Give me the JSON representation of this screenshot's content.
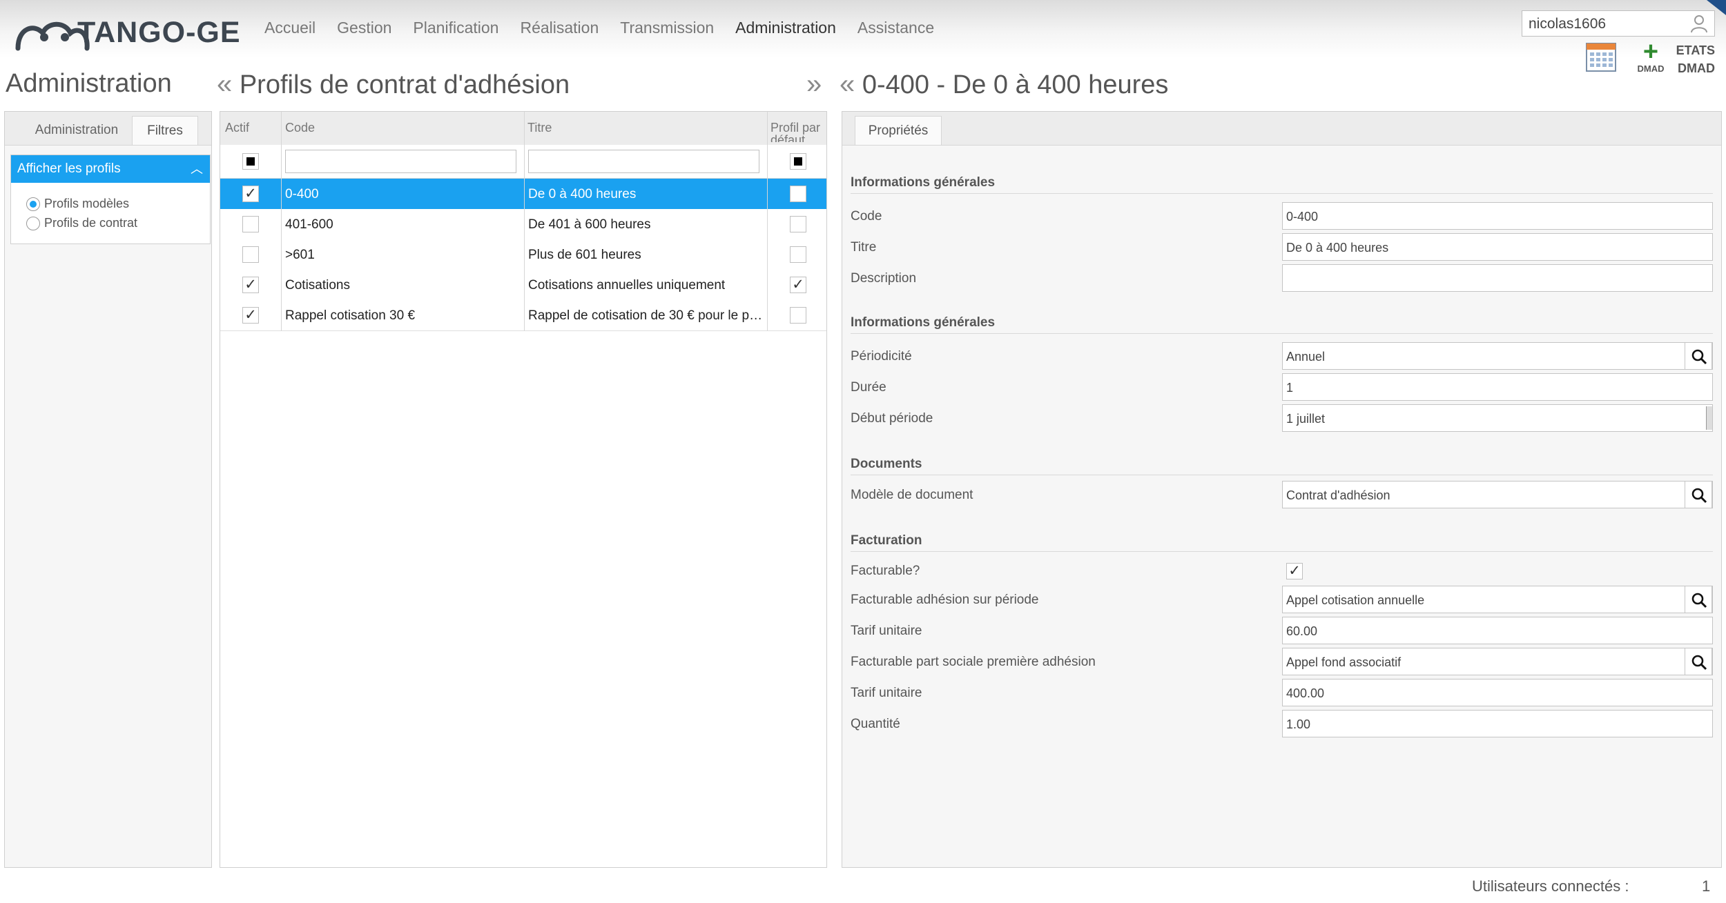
{
  "app": {
    "logo_text": "TANGO-GE",
    "menu": [
      "Accueil",
      "Gestion",
      "Planification",
      "Réalisation",
      "Transmission",
      "Administration",
      "Assistance"
    ],
    "active_menu": "Administration",
    "user": "nicolas1606",
    "tools": {
      "add_label": "DMAD",
      "etats_line1": "ETATS",
      "etats_line2": "DMAD"
    }
  },
  "headings": {
    "left": "Administration",
    "middle": "Profils de contrat d'adhésion",
    "right": "0-400 - De 0 à 400 heures"
  },
  "left_panel": {
    "tabs": [
      "Administration",
      "Filtres"
    ],
    "selected_tab": "Filtres",
    "filter_title": "Afficher les profils",
    "options": [
      "Profils modèles",
      "Profils de contrat"
    ],
    "selected_option": "Profils modèles"
  },
  "grid": {
    "columns": [
      "Actif",
      "Code",
      "Titre",
      "Profil par défaut"
    ],
    "rows": [
      {
        "actif": "✓",
        "code": "0-400",
        "titre": "De 0 à 400 heures",
        "defaut": ""
      },
      {
        "actif": "",
        "code": "401-600",
        "titre": "De 401 à 600 heures",
        "defaut": ""
      },
      {
        "actif": "",
        "code": ">601",
        "titre": "Plus de 601 heures",
        "defaut": ""
      },
      {
        "actif": "✓",
        "code": "Cotisations",
        "titre": "Cotisations annuelles uniquement",
        "defaut": "✓"
      },
      {
        "actif": "✓",
        "code": "Rappel cotisation 30 €",
        "titre": "Rappel de cotisation de 30 € pour le pr...",
        "defaut": ""
      }
    ],
    "selected_row": 0
  },
  "properties": {
    "tab": "Propriétés",
    "sections": [
      {
        "title": "Informations générales",
        "fields": [
          {
            "label": "Code",
            "value": "0-400"
          },
          {
            "label": "Titre",
            "value": "De 0 à 400 heures"
          },
          {
            "label": "Description",
            "value": ""
          }
        ]
      },
      {
        "title": "Informations générales",
        "fields": [
          {
            "label": "Périodicité",
            "value": "Annuel"
          },
          {
            "label": "Durée",
            "value": "1"
          },
          {
            "label": "Début période",
            "value": "1 juillet"
          }
        ]
      },
      {
        "title": "Documents",
        "fields": [
          {
            "label": "Modèle de document",
            "value": "Contrat d'adhésion"
          }
        ]
      },
      {
        "title": "Facturation",
        "fields": [
          {
            "label": "Facturable?",
            "value": "✓"
          },
          {
            "label": "Facturable adhésion sur période",
            "value": "Appel cotisation annuelle"
          },
          {
            "label": "Tarif unitaire",
            "value": "60.00"
          },
          {
            "label": "Facturable part sociale première adhésion",
            "value": "Appel fond associatif"
          },
          {
            "label": "Tarif unitaire",
            "value": "400.00"
          },
          {
            "label": "Quantité",
            "value": "1.00"
          }
        ]
      }
    ]
  },
  "footer": {
    "label": "Utilisateurs connectés :",
    "count": "1"
  },
  "colors": {
    "accent": "#1aa1f0",
    "brand": "#3d4650",
    "plus": "#2f8a2f"
  }
}
